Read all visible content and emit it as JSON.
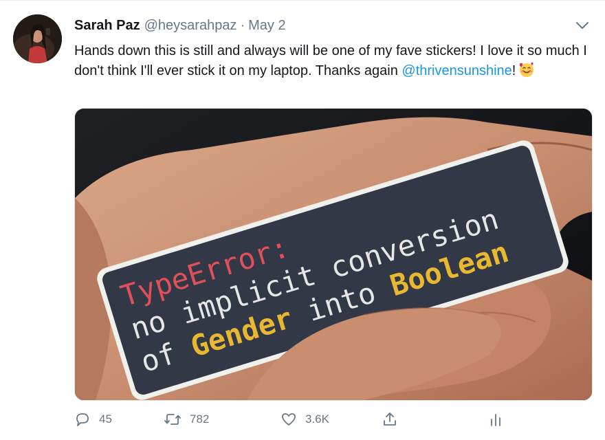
{
  "tweet": {
    "author_name": "Sarah Paz",
    "handle": "@heysarahpaz",
    "separator": "·",
    "date": "May 2",
    "text_before": "Hands down this is still and always will be one of my fave stickers! I love it so much I don't think I'll ever stick it on my laptop. Thanks again ",
    "mention": "@thrivensunshine",
    "text_after": "!",
    "emoji": "smiling-face-with-hearts-icon"
  },
  "sticker": {
    "line1": "TypeError:",
    "line2": "no implicit conversion",
    "line3_prefix": "of ",
    "line3_gender": "Gender",
    "line3_middle": " into ",
    "line3_boolean": "Boolean"
  },
  "actions": {
    "replies": "45",
    "retweets": "782",
    "likes": "3.6K"
  },
  "colors": {
    "text": "#14171a",
    "secondary": "#657786",
    "link": "#1b95e0",
    "sticker_bg": "#323845",
    "sticker_red": "#e0505a",
    "sticker_yellow": "#e8b833",
    "sticker_white": "#e6e6e6"
  }
}
